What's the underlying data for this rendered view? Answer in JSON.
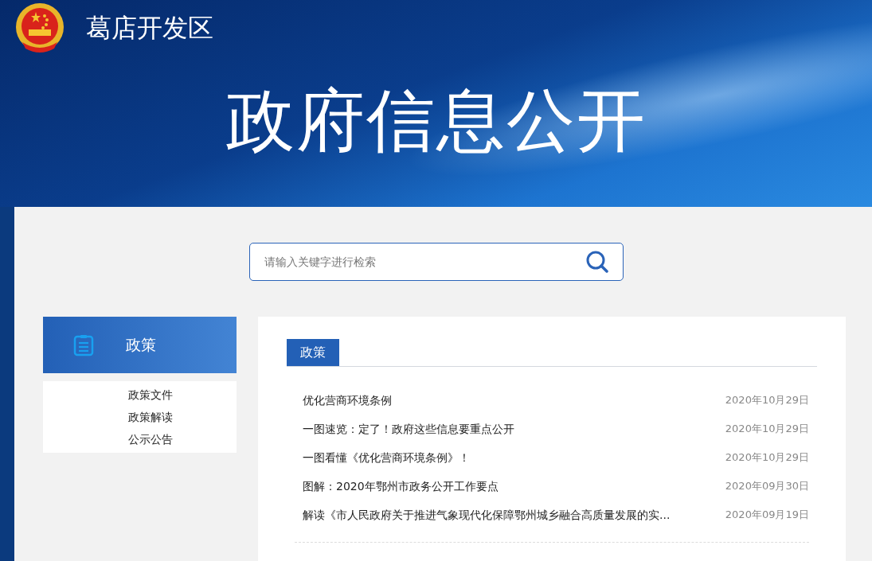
{
  "header": {
    "site_name": "葛店开发区",
    "banner_title": "政府信息公开"
  },
  "search": {
    "placeholder": "请输入关键字进行检索"
  },
  "sidebar": {
    "title": "政策",
    "items": [
      {
        "label": "政策文件"
      },
      {
        "label": "政策解读"
      },
      {
        "label": "公示公告"
      }
    ]
  },
  "tabs": [
    {
      "label": "政策",
      "selected": true
    }
  ],
  "articles": [
    {
      "title": "优化营商环境条例",
      "date": "2020年10月29日"
    },
    {
      "title": "一图速览：定了！政府这些信息要重点公开",
      "date": "2020年10月29日"
    },
    {
      "title": "一图看懂《优化营商环境条例》！",
      "date": "2020年10月29日"
    },
    {
      "title": "图解：2020年鄂州市政务公开工作要点",
      "date": "2020年09月30日"
    },
    {
      "title": "解读《市人民政府关于推进气象现代化保障鄂州城乡融合高质量发展的实...",
      "date": "2020年09月19日"
    }
  ]
}
